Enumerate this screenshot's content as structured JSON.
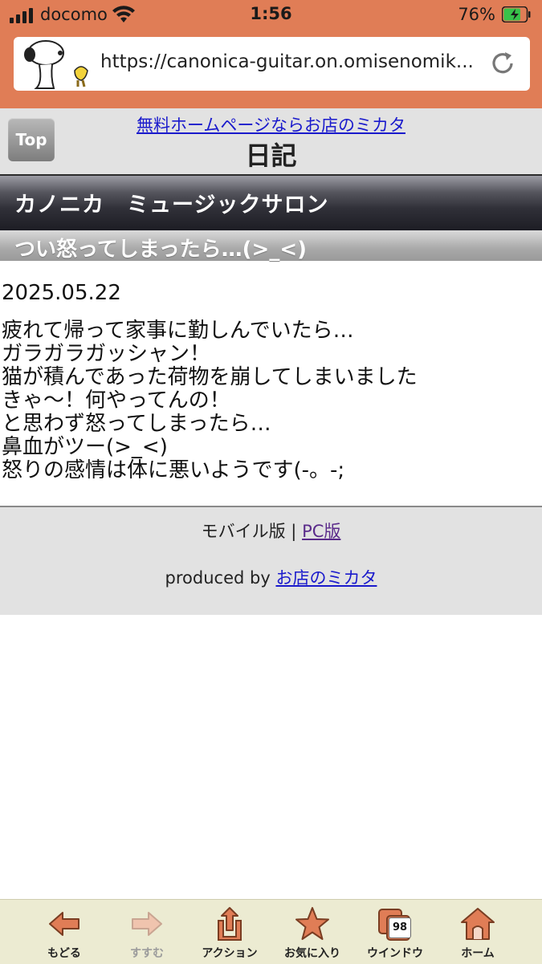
{
  "status_bar": {
    "carrier": "docomo",
    "time": "1:56",
    "battery": "76%",
    "battery_level": 0.76
  },
  "browser": {
    "url": "https://canonica-guitar.on.omisenomik..."
  },
  "header": {
    "top_button_label": "Top",
    "ad_link": "無料ホームページならお店のミカタ",
    "page_title": "日記"
  },
  "site": {
    "name": "カノニカ　ミュージックサロン"
  },
  "entry": {
    "title": "つい怒ってしまったら…(>_<)",
    "date": "2025.05.22",
    "lines": [
      "疲れて帰って家事に勤しんでいたら…",
      "ガラガラガッシャン！",
      "猫が積んであった荷物を崩してしまいました",
      "きゃ〜！何やってんの！",
      "と思わず怒ってしまったら…",
      "鼻血がツー(>_<)",
      "怒りの感情は体に悪いようです(-。-;"
    ]
  },
  "footer": {
    "mobile_label": "モバイル版",
    "separator": "|",
    "pc_link": "PC版",
    "produced_by": "produced by",
    "producer_link": "お店のミカタ"
  },
  "toolbar": {
    "items": [
      {
        "label": "もどる",
        "icon": "back-arrow-icon",
        "enabled": true
      },
      {
        "label": "すすむ",
        "icon": "forward-arrow-icon",
        "enabled": false
      },
      {
        "label": "アクション",
        "icon": "share-icon",
        "enabled": true
      },
      {
        "label": "お気に入り",
        "icon": "star-icon",
        "enabled": true
      },
      {
        "label": "ウインドウ",
        "icon": "windows-icon",
        "enabled": true,
        "count": "98"
      },
      {
        "label": "ホーム",
        "icon": "home-icon",
        "enabled": true
      }
    ]
  },
  "colors": {
    "browser_accent": "#e07d56",
    "toolbar_icon": "#e07d56",
    "link": "#1a1acc"
  }
}
